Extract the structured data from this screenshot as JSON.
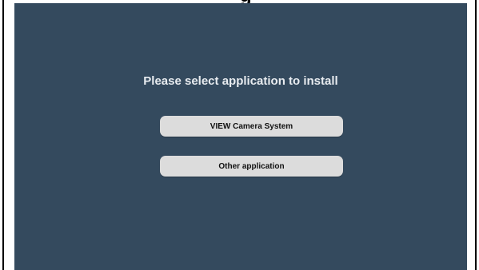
{
  "screen": {
    "prompt": "Please select application to install",
    "options": [
      {
        "label": "VIEW Camera System"
      },
      {
        "label": "Other application"
      }
    ],
    "background_color": "#344a5e",
    "button_color": "#dcdcdc"
  }
}
